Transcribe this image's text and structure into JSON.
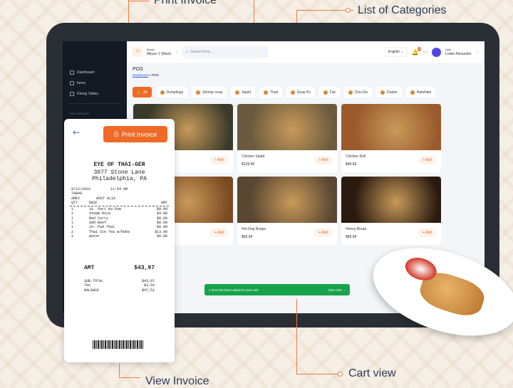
{
  "callouts": {
    "print": "Print Invoice",
    "categories": "List of Categories",
    "view": "View Invoice",
    "cart": "Cart view"
  },
  "header": {
    "branch_label": "Branch",
    "branch": "Mirpur-1 (Main)",
    "search_placeholder": "Search here...",
    "language": "English",
    "notif_count": "99",
    "hello": "Hello",
    "user": "Leslie Alexander"
  },
  "sidebar": {
    "items": [
      "Dashboard",
      "Items",
      "Dining Tables"
    ],
    "section": "POS GROUPS"
  },
  "page": {
    "title": "POS",
    "breadcrumb_home": "Dashboard",
    "breadcrumb_current": "POS"
  },
  "categories": [
    "All",
    "Dumplings",
    "Shrimp soup",
    "Squid",
    "Thali",
    "Soup Po",
    "Dal",
    "Cha Gio",
    "Dudan",
    "HaloHalo"
  ],
  "products": [
    {
      "name": "",
      "price": "",
      "color": "#3a3a2a"
    },
    {
      "name": "Chicken Salad",
      "price": "$129.99",
      "color": "#6b5a3e"
    },
    {
      "name": "Chicken Roll",
      "price": "$49.99",
      "color": "#9a5a2c"
    },
    {
      "name": "",
      "price": "",
      "color": "#7a4a22"
    },
    {
      "name": "Hot Dog Burger",
      "price": "$59.99",
      "color": "#5a4632"
    },
    {
      "name": "Honey Bread",
      "price": "$69.99",
      "color": "#2a1a10"
    }
  ],
  "add_label": "+ Add",
  "toast": {
    "text": "1 item has been added in your cart",
    "action": "View Cart →"
  },
  "receipt": {
    "print_label": "Print Invoice",
    "store": "EYE OF THAI-GER",
    "addr1": "3077 Stone Lane",
    "addr2": "Philadelphia, PA",
    "date": "9/12/2016",
    "time": "11:54 AM",
    "code": "TAB49",
    "card": "AMEX",
    "host": "HOST ALIA",
    "cols": [
      "QTY",
      "DESC",
      "AMT"
    ],
    "items": [
      [
        "1",
        "31. Part Ka Pow",
        "$8.99"
      ],
      [
        "1",
        "Steam Rice",
        "$4.00"
      ],
      [
        "1",
        "Red Curry",
        "$8.99"
      ],
      [
        "1",
        "add Beef",
        "$0.00"
      ],
      [
        "1",
        "19. Pad Thai",
        "$8.99"
      ],
      [
        "2",
        "Thai Ice Tea w/boba",
        "$13.00"
      ],
      [
        "1",
        "water",
        "$0.00"
      ]
    ],
    "amt_label": "AMT",
    "amt": "$43,97",
    "subtotal_label": "SUB-TOTAL",
    "subtotal": "$43,97",
    "tax_label": "TAX",
    "tax": "$3,54",
    "balance_label": "BALANCE",
    "balance": "$47,51"
  },
  "colors": {
    "accent": "#ef6a25",
    "success": "#16a34a",
    "sidebar": "#131a24"
  }
}
